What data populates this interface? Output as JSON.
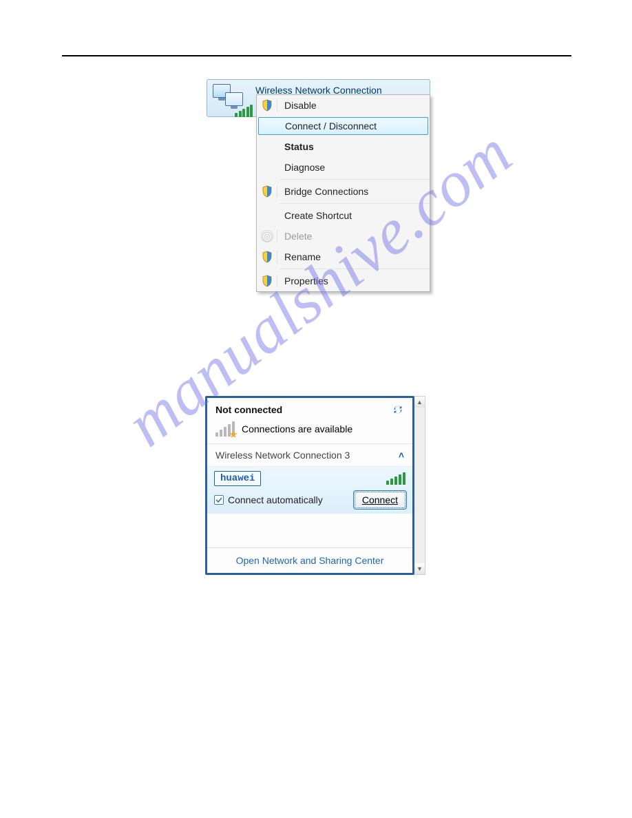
{
  "watermark": "manualshive.com",
  "context_menu": {
    "title": "Wireless Network Connection",
    "items": {
      "disable": "Disable",
      "connect_disconnect": "Connect / Disconnect",
      "status": "Status",
      "diagnose": "Diagnose",
      "bridge": "Bridge Connections",
      "create_shortcut": "Create Shortcut",
      "delete": "Delete",
      "rename": "Rename",
      "properties": "Properties"
    }
  },
  "wifi_flyout": {
    "status_title": "Not connected",
    "available_text": "Connections are available",
    "section_label": "Wireless Network Connection 3",
    "ssid": "huawei",
    "auto_label": "Connect automatically",
    "auto_checked": true,
    "connect_button": "Connect",
    "bottom_link": "Open Network and Sharing Center"
  }
}
